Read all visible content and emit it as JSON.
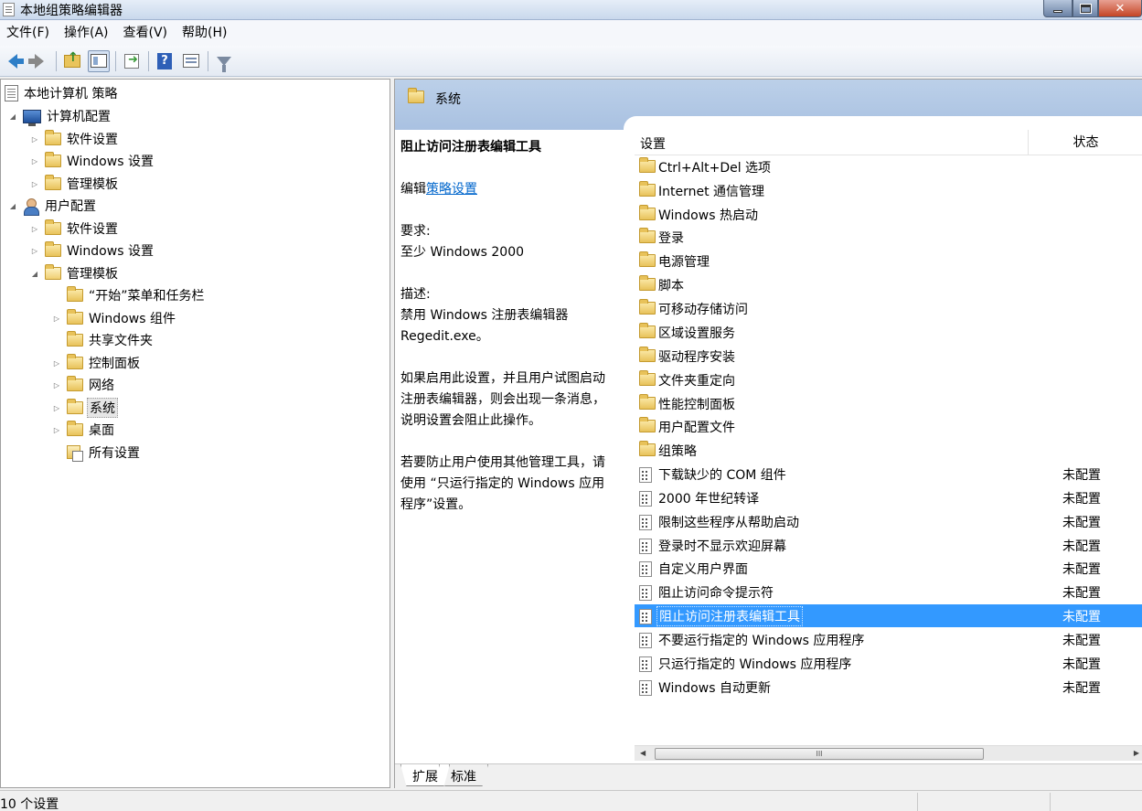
{
  "window": {
    "title": "本地组策略编辑器"
  },
  "menu": [
    "文件(F)",
    "操作(A)",
    "查看(V)",
    "帮助(H)"
  ],
  "tree": {
    "root": "本地计算机 策略",
    "computer_config": "计算机配置",
    "cc_software": "软件设置",
    "cc_windows": "Windows 设置",
    "cc_admin": "管理模板",
    "user_config": "用户配置",
    "uc_software": "软件设置",
    "uc_windows": "Windows 设置",
    "uc_admin": "管理模板",
    "start_menu": "“开始”菜单和任务栏",
    "win_components": "Windows 组件",
    "shared_folders": "共享文件夹",
    "control_panel": "控制面板",
    "network": "网络",
    "system": "系统",
    "desktop": "桌面",
    "all_settings": "所有设置"
  },
  "header": {
    "title": "系统"
  },
  "description": {
    "title": "阻止访问注册表编辑工具",
    "edit_prefix": "编辑",
    "edit_link": "策略设置",
    "req_label": "要求:",
    "req_value": "至少 Windows 2000",
    "desc_label": "描述:",
    "desc_l1": "禁用 Windows 注册表编辑器",
    "desc_l2": "Regedit.exe。",
    "p2_l1": "如果启用此设置，并且用户试图启动",
    "p2_l2": "注册表编辑器，则会出现一条消息，",
    "p2_l3": "说明设置会阻止此操作。",
    "p3_l1": "若要防止用户使用其他管理工具，请",
    "p3_l2": "使用 “只运行指定的 Windows 应用",
    "p3_l3": "程序”设置。"
  },
  "list": {
    "col_setting": "设置",
    "col_state": "状态",
    "folders": [
      "Ctrl+Alt+Del 选项",
      "Internet 通信管理",
      "Windows 热启动",
      "登录",
      "电源管理",
      "脚本",
      "可移动存储访问",
      "区域设置服务",
      "驱动程序安装",
      "文件夹重定向",
      "性能控制面板",
      "用户配置文件",
      "组策略"
    ],
    "policies": [
      {
        "name": "下载缺少的 COM 组件",
        "state": "未配置"
      },
      {
        "name": "2000 年世纪转译",
        "state": "未配置"
      },
      {
        "name": "限制这些程序从帮助启动",
        "state": "未配置"
      },
      {
        "name": "登录时不显示欢迎屏幕",
        "state": "未配置"
      },
      {
        "name": "自定义用户界面",
        "state": "未配置"
      },
      {
        "name": "阻止访问命令提示符",
        "state": "未配置"
      },
      {
        "name": "阻止访问注册表编辑工具",
        "state": "未配置"
      },
      {
        "name": "不要运行指定的 Windows 应用程序",
        "state": "未配置"
      },
      {
        "name": "只运行指定的 Windows 应用程序",
        "state": "未配置"
      },
      {
        "name": "Windows 自动更新",
        "state": "未配置"
      }
    ]
  },
  "scroll": {
    "thumb": "III"
  },
  "tabs": {
    "extended": "扩展",
    "standard": "标准"
  },
  "status": {
    "text": "10 个设置"
  },
  "colors": {
    "selection": "#3399ff",
    "header": "#bcd0e9",
    "link": "#0066cc"
  }
}
